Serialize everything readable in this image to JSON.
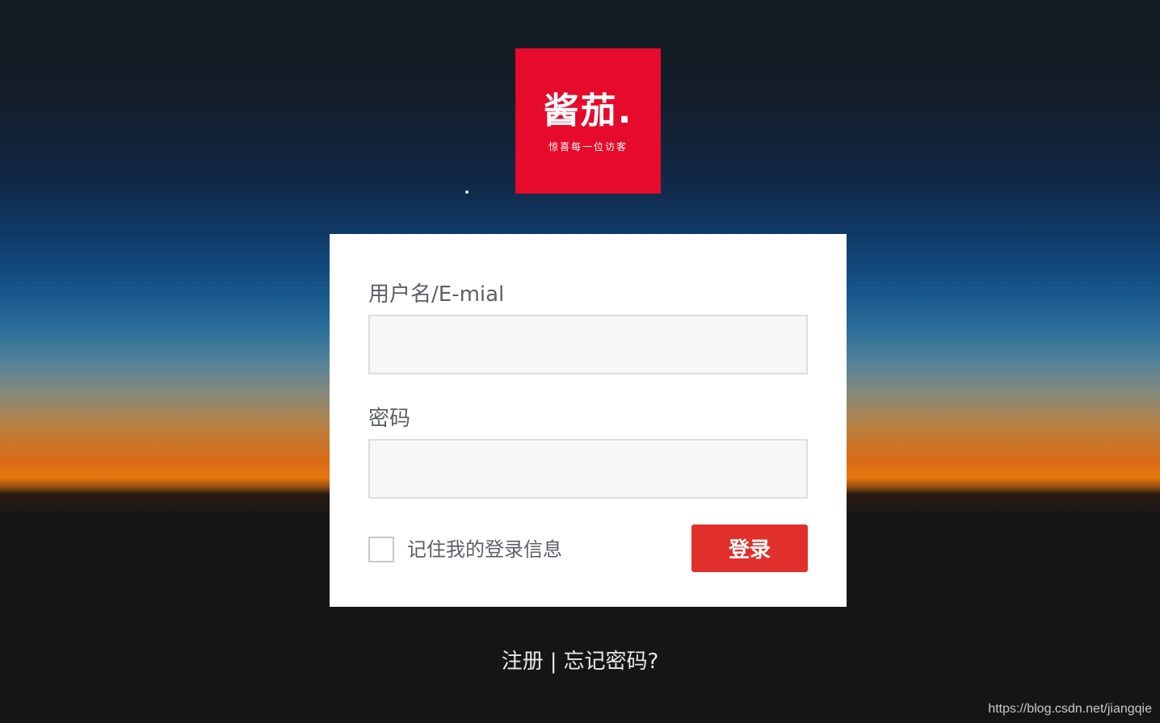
{
  "logo": {
    "main_text": "酱茄.",
    "sub_text": "惊喜每一位访客",
    "color": "#e60b2a"
  },
  "form": {
    "username_label": "用户名/E-mial",
    "username_value": "",
    "password_label": "密码",
    "password_value": "",
    "remember_label": "记住我的登录信息",
    "remember_checked": false,
    "submit_label": "登录",
    "submit_color": "#e1302b"
  },
  "links": {
    "register": "注册",
    "separator": "|",
    "forgot": "忘记密码?"
  },
  "watermark": "https://blog.csdn.net/jiangqie"
}
